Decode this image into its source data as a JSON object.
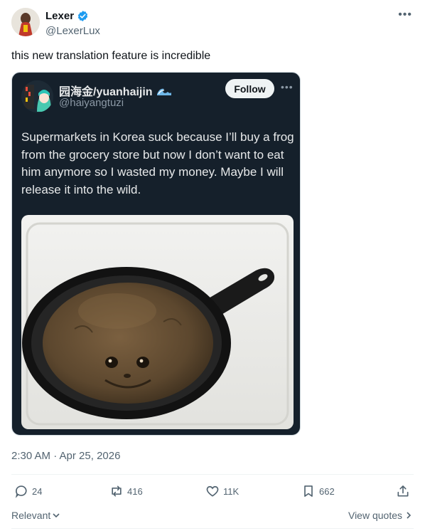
{
  "author": {
    "name": "Lexer",
    "handle": "@LexerLux",
    "verified_color": "#1d9bf0",
    "avatar_icon": "avatar-figure-icon"
  },
  "tweet": {
    "text": "this new translation feature is incredible",
    "timestamp": "2:30 AM · Apr 25, 2026"
  },
  "quoted": {
    "name": "园海金/yuanhaijin",
    "handle": "@haiyangtuzi",
    "follow_label": "Follow",
    "text": "Supermarkets in Korea suck because I’ll buy a frog from the grocery store but now I don’t want to eat him anymore so I wasted my money. Maybe I will release it into the wild.",
    "image_icon": "frog-in-pan-photo",
    "name_emoji_icon": "wave-icon",
    "background_color": "#15202b"
  },
  "actions": {
    "replies": "24",
    "reposts": "416",
    "likes": "11K",
    "bookmarks": "662"
  },
  "footer": {
    "sort_label": "Relevant",
    "view_quotes_label": "View quotes"
  }
}
